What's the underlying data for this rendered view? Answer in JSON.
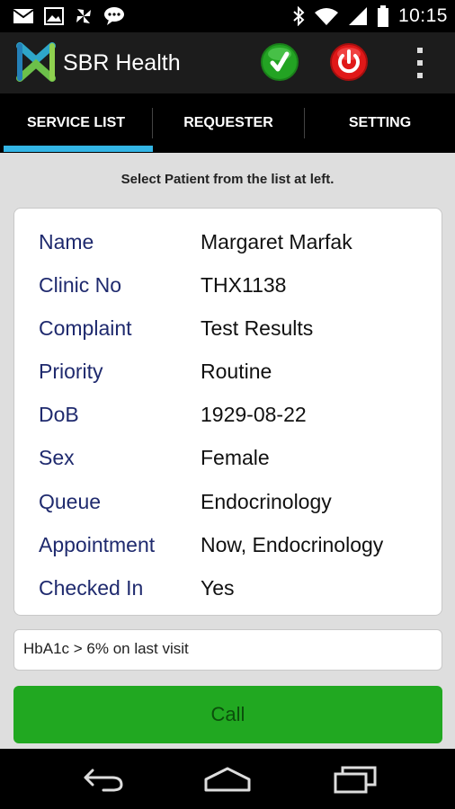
{
  "status_bar": {
    "time": "10:15",
    "icons": [
      "mail-icon",
      "image-icon",
      "pinwheel-icon",
      "chat-icon",
      "bluetooth-icon",
      "wifi-icon",
      "signal-icon",
      "battery-icon"
    ]
  },
  "app_bar": {
    "title": "SBR Health",
    "actions": [
      "check-icon",
      "power-icon",
      "overflow-menu-icon"
    ]
  },
  "tabs": [
    {
      "label": "SERVICE LIST",
      "selected": true
    },
    {
      "label": "REQUESTER",
      "selected": false
    },
    {
      "label": "SETTING",
      "selected": false
    }
  ],
  "instruction": "Select Patient from the list at left.",
  "patient": [
    {
      "label": "Name",
      "value": "Margaret Marfak"
    },
    {
      "label": "Clinic No",
      "value": "THX1138"
    },
    {
      "label": "Complaint",
      "value": "Test Results"
    },
    {
      "label": "Priority",
      "value": "Routine"
    },
    {
      "label": "DoB",
      "value": "1929-08-22"
    },
    {
      "label": "Sex",
      "value": "Female"
    },
    {
      "label": "Queue",
      "value": "Endocrinology"
    },
    {
      "label": "Appointment",
      "value": "Now, Endocrinology"
    },
    {
      "label": "Checked In",
      "value": "Yes"
    }
  ],
  "note": "HbA1c > 6% on last visit",
  "call_button": "Call",
  "nav": [
    "back-icon",
    "home-icon",
    "recents-icon"
  ],
  "colors": {
    "accent_tab": "#33b5e5",
    "call_green": "#21a821",
    "label_blue": "#1f2a6e",
    "power_red": "#e01818",
    "check_green": "#23a323"
  }
}
